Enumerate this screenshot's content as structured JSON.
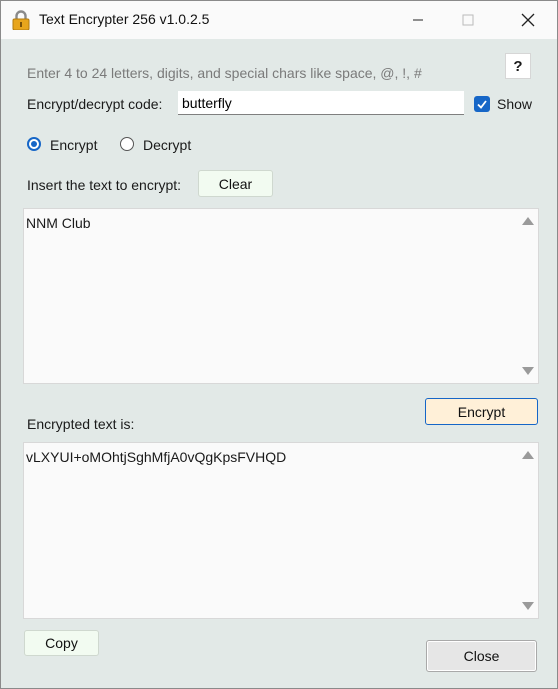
{
  "window": {
    "title": "Text Encrypter 256 v1.0.2.5",
    "icon": "padlock-icon",
    "controls": [
      "minimize-icon",
      "maximize-icon",
      "close-icon"
    ]
  },
  "hint": "Enter 4 to 24 letters, digits, and special chars like space, @, !,  #",
  "help_label": "?",
  "code": {
    "label": "Encrypt/decrypt code:",
    "value": "butterfly",
    "show_label": "Show",
    "show_checked": true
  },
  "mode": {
    "encrypt_label": "Encrypt",
    "decrypt_label": "Decrypt",
    "selected": "Encrypt"
  },
  "input": {
    "label": "Insert the text to encrypt:",
    "clear_label": "Clear",
    "text": "NNM Club"
  },
  "action": {
    "encrypt_label": "Encrypt"
  },
  "output": {
    "label": "Encrypted text is:",
    "text": "vLXYUI+oMOhtjSghMfjA0vQgKpsFVHQD",
    "copy_label": "Copy"
  },
  "close_label": "Close",
  "colors": {
    "accent": "#1666c7",
    "window_bg": "#e2e9e7",
    "encrypt_button_bg": "#fff0d8",
    "green_button_bg": "#f2fbf1"
  }
}
